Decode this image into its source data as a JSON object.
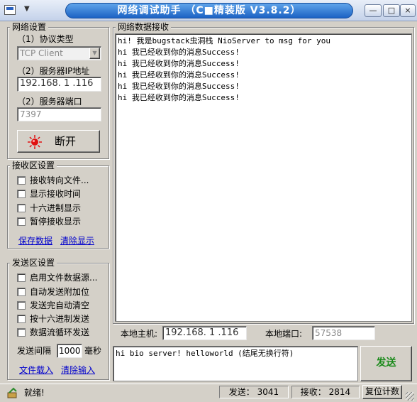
{
  "window": {
    "title": "网络调试助手 （C■精装版 V3.8.2）",
    "system_icon": "app-icon",
    "minimize": "—",
    "maximize": "□",
    "close": "×"
  },
  "net_settings": {
    "title": "网络设置",
    "protocol_label": "（1）协议类型",
    "protocol_value": "TCP Client",
    "ip_label": "（2）服务器IP地址",
    "ip_value": "192.168. 1 .116",
    "port_label": "（2）服务器端口",
    "port_value": "7397",
    "disconnect_label": "断开"
  },
  "receive_settings": {
    "title": "接收区设置",
    "options": [
      "接收转向文件...",
      "显示接收时间",
      "十六进制显示",
      "暂停接收显示"
    ],
    "save_link": "保存数据",
    "clear_link": "清除显示"
  },
  "send_settings": {
    "title": "发送区设置",
    "options": [
      "启用文件数据源...",
      "自动发送附加位",
      "发送完自动清空",
      "按十六进制发送",
      "数据流循环发送"
    ],
    "interval_label": "发送间隔",
    "interval_value": "1000",
    "interval_unit": "毫秒",
    "file_link": "文件载入",
    "clear_link": "清除输入"
  },
  "receive_area": {
    "title": "网络数据接收",
    "lines": [
      "hi! 我是bugstack虫洞栈 NioServer to msg for you",
      "hi 我已经收到你的消息Success!",
      "hi 我已经收到你的消息Success!",
      "hi 我已经收到你的消息Success!",
      "hi 我已经收到你的消息Success!",
      "hi 我已经收到你的消息Success!"
    ]
  },
  "local_info": {
    "host_label": "本地主机:",
    "host_value": "192.168. 1 .116",
    "port_label": "本地端口:",
    "port_value": "57538"
  },
  "send_area": {
    "text": "hi bio server! helloworld (结尾无换行符)",
    "send_button": "发送"
  },
  "status": {
    "ready": "就绪!",
    "sent_label": "发送：",
    "sent_value": "3041",
    "recv_label": "接收：",
    "recv_value": "2814",
    "reset_label": "复位计数"
  }
}
